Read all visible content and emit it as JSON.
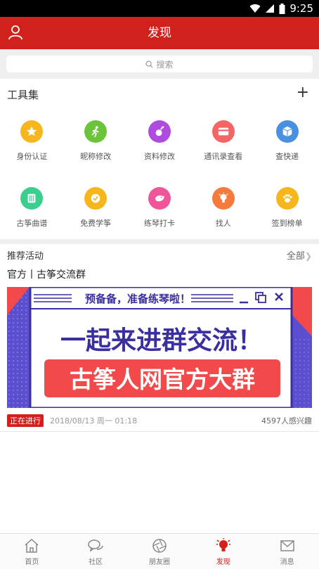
{
  "status_bar": {
    "time": "9:25"
  },
  "header": {
    "title": "发现"
  },
  "search": {
    "placeholder": "搜索"
  },
  "tools": {
    "heading": "工具集",
    "add_label": "+",
    "items": [
      {
        "label": "身份认证",
        "color": "#f7b61c",
        "icon": "star-icon"
      },
      {
        "label": "昵称修改",
        "color": "#6cc43a",
        "icon": "runner-icon"
      },
      {
        "label": "资料修改",
        "color": "#b04be0",
        "icon": "bottle-icon"
      },
      {
        "label": "通讯录查看",
        "color": "#f56565",
        "icon": "card-icon"
      },
      {
        "label": "查快递",
        "color": "#4a90e2",
        "icon": "package-icon"
      },
      {
        "label": "古筝曲谱",
        "color": "#3bcf8e",
        "icon": "score-icon"
      },
      {
        "label": "免费学筝",
        "color": "#f7b61c",
        "icon": "check-badge-icon"
      },
      {
        "label": "练琴打卡",
        "color": "#f0559a",
        "icon": "bird-icon"
      },
      {
        "label": "找人",
        "color": "#f57a3c",
        "icon": "bulb-icon"
      },
      {
        "label": "签到榜单",
        "color": "#f7b61c",
        "icon": "paw-icon"
      }
    ]
  },
  "recommend": {
    "heading": "推荐活动",
    "all_label": "全部",
    "activity": {
      "title": "官方丨古筝交流群",
      "banner_line1": "预备备，准备练琴啦！",
      "banner_line2": "一起来进群交流！",
      "banner_line3": "古筝人网官方大群",
      "status": "正在进行",
      "datetime": "2018/08/13 周一 01:18",
      "interest": "4597人感兴趣"
    }
  },
  "tabbar": {
    "items": [
      {
        "label": "首页",
        "icon": "home-icon",
        "active": false
      },
      {
        "label": "社区",
        "icon": "chat-icon",
        "active": false
      },
      {
        "label": "朋友圈",
        "icon": "aperture-icon",
        "active": false
      },
      {
        "label": "发现",
        "icon": "bulb-icon",
        "active": true
      },
      {
        "label": "消息",
        "icon": "mail-icon",
        "active": false
      }
    ]
  },
  "colors": {
    "brand": "#d0211c",
    "banner_purple": "#3a2fa0",
    "banner_red": "#f24a4a"
  }
}
